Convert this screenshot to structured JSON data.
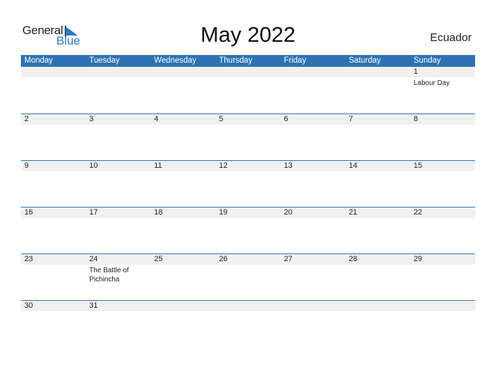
{
  "logo": {
    "general": "General",
    "blue": "Blue"
  },
  "title": "May 2022",
  "country": "Ecuador",
  "colors": {
    "accent": "#2e72b4",
    "band": "#f0f0f0",
    "logo_blue": "#2a7bc4"
  },
  "weekdays": [
    "Monday",
    "Tuesday",
    "Wednesday",
    "Thursday",
    "Friday",
    "Saturday",
    "Sunday"
  ],
  "weeks": [
    [
      {
        "d": ""
      },
      {
        "d": ""
      },
      {
        "d": ""
      },
      {
        "d": ""
      },
      {
        "d": ""
      },
      {
        "d": ""
      },
      {
        "d": "1",
        "e": "Labour Day"
      }
    ],
    [
      {
        "d": "2"
      },
      {
        "d": "3"
      },
      {
        "d": "4"
      },
      {
        "d": "5"
      },
      {
        "d": "6"
      },
      {
        "d": "7"
      },
      {
        "d": "8"
      }
    ],
    [
      {
        "d": "9"
      },
      {
        "d": "10"
      },
      {
        "d": "11"
      },
      {
        "d": "12"
      },
      {
        "d": "13"
      },
      {
        "d": "14"
      },
      {
        "d": "15"
      }
    ],
    [
      {
        "d": "16"
      },
      {
        "d": "17"
      },
      {
        "d": "18"
      },
      {
        "d": "19"
      },
      {
        "d": "20"
      },
      {
        "d": "21"
      },
      {
        "d": "22"
      }
    ],
    [
      {
        "d": "23"
      },
      {
        "d": "24",
        "e": "The Battle of Pichincha"
      },
      {
        "d": "25"
      },
      {
        "d": "26"
      },
      {
        "d": "27"
      },
      {
        "d": "28"
      },
      {
        "d": "29"
      }
    ],
    [
      {
        "d": "30"
      },
      {
        "d": "31"
      },
      {
        "d": ""
      },
      {
        "d": ""
      },
      {
        "d": ""
      },
      {
        "d": ""
      },
      {
        "d": ""
      }
    ]
  ]
}
